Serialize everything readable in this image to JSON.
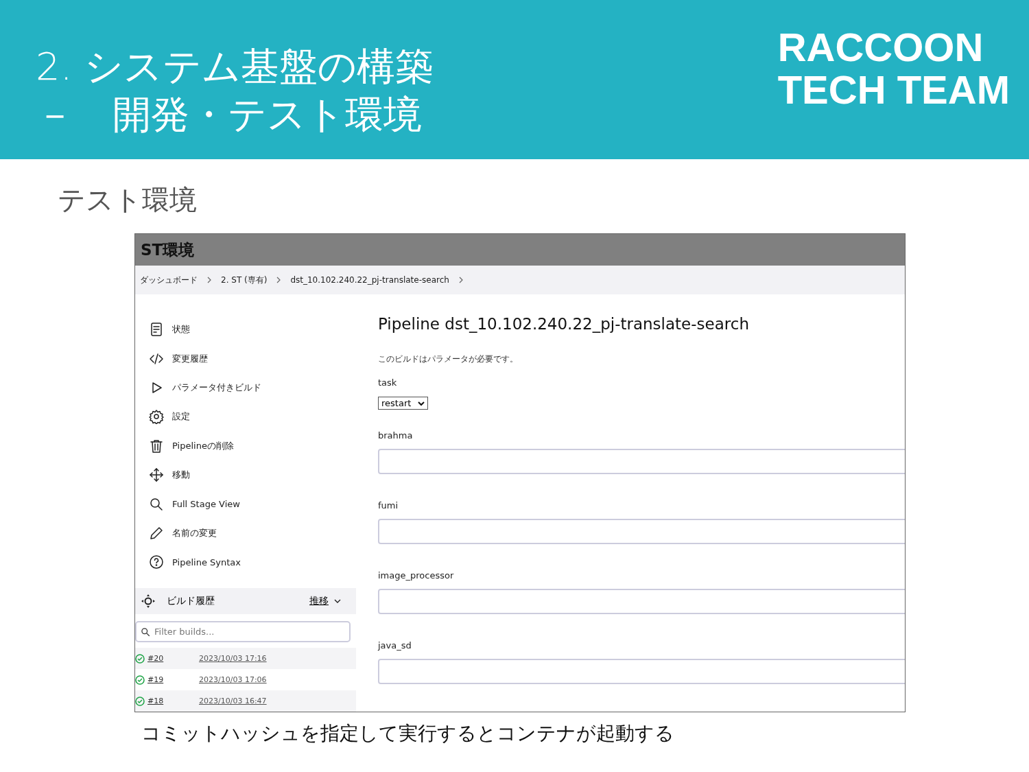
{
  "slide": {
    "title_lines": [
      "2. システム基盤の構築",
      "－　開発・テスト環境"
    ],
    "logo_lines": [
      "RACCOON",
      "TECH TEAM"
    ],
    "subtitle": "テスト環境",
    "caption": "コミットハッシュを指定して実行するとコンテナが起動する"
  },
  "screenshot": {
    "title": "ST環境",
    "breadcrumbs": [
      "ダッシュボード",
      "2. ST (専有)",
      "dst_10.102.240.22_pj-translate-search"
    ],
    "sidebar": [
      {
        "kind": "status",
        "label": "状態"
      },
      {
        "kind": "code",
        "label": "変更履歴"
      },
      {
        "kind": "play",
        "label": "パラメータ付きビルド"
      },
      {
        "kind": "gear",
        "label": "設定"
      },
      {
        "kind": "trash",
        "label": "Pipelineの削除"
      },
      {
        "kind": "move",
        "label": "移動"
      },
      {
        "kind": "search",
        "label": "Full Stage View"
      },
      {
        "kind": "pencil",
        "label": "名前の変更"
      },
      {
        "kind": "help",
        "label": "Pipeline Syntax"
      }
    ],
    "build_history": {
      "title": "ビルド履歴",
      "trend": "推移",
      "filter_placeholder": "Filter builds...",
      "builds": [
        {
          "number": "#20",
          "time": "2023/10/03 17:16"
        },
        {
          "number": "#19",
          "time": "2023/10/03 17:06"
        },
        {
          "number": "#18",
          "time": "2023/10/03 16:47"
        }
      ]
    },
    "heading": "Pipeline dst_10.102.240.22_pj-translate-search",
    "note": "このビルドはパラメータが必要です。",
    "parameters": [
      {
        "kind": "select",
        "label": "task",
        "value": "restart"
      },
      {
        "kind": "text",
        "label": "brahma"
      },
      {
        "kind": "text",
        "label": "fumi"
      },
      {
        "kind": "text",
        "label": "image_processor"
      },
      {
        "kind": "text",
        "label": "java_sd"
      }
    ]
  }
}
